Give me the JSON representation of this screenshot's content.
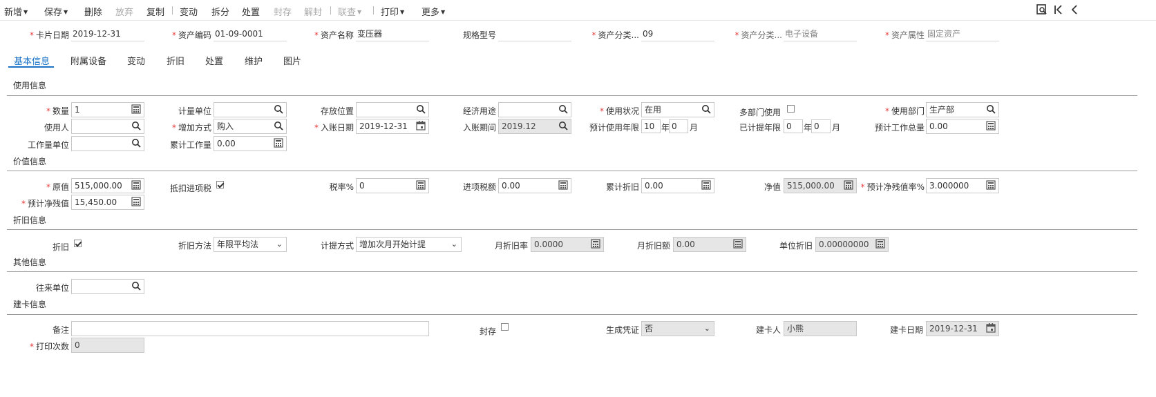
{
  "toolbar": {
    "add": "新增",
    "save": "保存",
    "delete": "删除",
    "discard": "放弃",
    "copy": "复制",
    "change": "变动",
    "split": "拆分",
    "dispose": "处置",
    "seal": "封存",
    "unseal": "解封",
    "inquiry": "联查",
    "print": "打印",
    "more": "更多",
    "icons": [
      "preview-icon",
      "first-page-icon",
      "back-icon"
    ]
  },
  "header": {
    "card_date_label": "卡片日期",
    "card_date": "2019-12-31",
    "asset_code_label": "资产编码",
    "asset_code": "01-09-0001",
    "asset_name_label": "资产名称",
    "asset_name": "变压器",
    "spec_label": "规格型号",
    "spec": "",
    "category_code_label": "资产分类...",
    "category_code": "09",
    "category_name_label": "资产分类...",
    "category_name": "电子设备",
    "attribute_label": "资产属性",
    "attribute": "固定资产"
  },
  "tabs": [
    "基本信息",
    "附属设备",
    "变动",
    "折旧",
    "处置",
    "维护",
    "图片"
  ],
  "sections": {
    "usage": "使用信息",
    "value": "价值信息",
    "depreciation": "折旧信息",
    "other": "其他信息",
    "card": "建卡信息"
  },
  "usage": {
    "quantity_label": "数量",
    "quantity": "1",
    "unit_label": "计量单位",
    "unit": "",
    "location_label": "存放位置",
    "location": "",
    "purpose_label": "经济用途",
    "purpose": "",
    "status_label": "使用状况",
    "status": "在用",
    "multi_dept_label": "多部门使用",
    "dept_label": "使用部门",
    "dept": "生产部",
    "user_label": "使用人",
    "user": "",
    "add_method_label": "增加方式",
    "add_method": "购入",
    "entry_date_label": "入账日期",
    "entry_date": "2019-12-31",
    "entry_period_label": "入账期间",
    "entry_period": "2019.12",
    "life_label": "预计使用年限",
    "life_years": "10",
    "life_months": "0",
    "accrued_label": "已计提年限",
    "accrued_years": "0",
    "accrued_months": "0",
    "year_unit": "年",
    "month_unit": "月",
    "total_work_label": "预计工作总量",
    "total_work": "0.00",
    "work_unit_label": "工作量单位",
    "work_unit": "",
    "cum_work_label": "累计工作量",
    "cum_work": "0.00"
  },
  "value": {
    "original_label": "原值",
    "original": "515,000.00",
    "deduct_tax_label": "抵扣进项税",
    "tax_rate_label": "税率%",
    "tax_rate": "0",
    "input_tax_label": "进项税额",
    "input_tax": "0.00",
    "cum_dep_label": "累计折旧",
    "cum_dep": "0.00",
    "net_label": "净值",
    "net": "515,000.00",
    "residual_rate_label": "预计净残值率%",
    "residual_rate": "3.000000",
    "residual_label": "预计净残值",
    "residual": "15,450.00"
  },
  "depreciation": {
    "dep_label": "折旧",
    "method_label": "折旧方法",
    "method": "年限平均法",
    "accrual_label": "计提方式",
    "accrual": "增加次月开始计提",
    "monthly_rate_label": "月折旧率",
    "monthly_rate": "0.0000",
    "monthly_amount_label": "月折旧额",
    "monthly_amount": "0.00",
    "unit_dep_label": "单位折旧",
    "unit_dep": "0.00000000"
  },
  "other": {
    "partner_label": "往来单位",
    "partner": ""
  },
  "card": {
    "remark_label": "备注",
    "remark": "",
    "seal_label": "封存",
    "voucher_label": "生成凭证",
    "voucher": "否",
    "creator_label": "建卡人",
    "creator": "小熊",
    "create_date_label": "建卡日期",
    "create_date": "2019-12-31",
    "print_count_label": "打印次数",
    "print_count": "0"
  }
}
